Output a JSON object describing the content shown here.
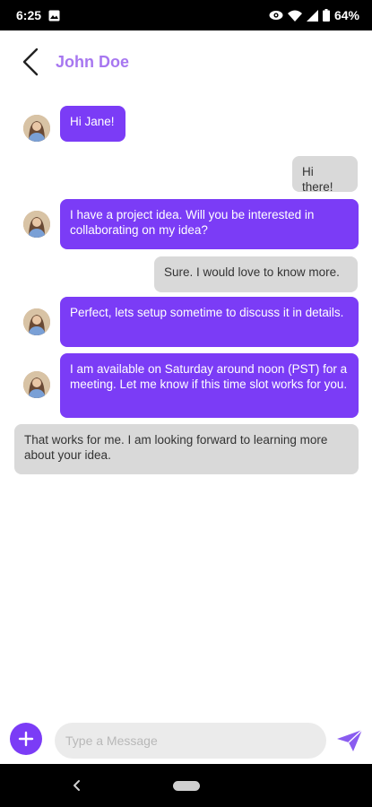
{
  "status_bar": {
    "time": "6:25",
    "battery": "64%",
    "icons": [
      "image-icon",
      "eye-icon",
      "wifi-icon",
      "signal-icon",
      "battery-icon"
    ]
  },
  "header": {
    "back_icon": "chevron-left-icon",
    "contact_name": "John Doe"
  },
  "messages": [
    {
      "from": "contact",
      "text": "Hi Jane!"
    },
    {
      "from": "me",
      "text": "Hi there!"
    },
    {
      "from": "contact",
      "text": "I have a project idea. Will you be interested in collaborating on my idea?"
    },
    {
      "from": "me",
      "text": "Sure. I would love to know more."
    },
    {
      "from": "contact",
      "text": "Perfect, lets setup sometime to discuss it in details."
    },
    {
      "from": "contact",
      "text": "I am available on Saturday around noon (PST) for a meeting. Let me know if this time slot works for you."
    },
    {
      "from": "me",
      "text": "That works for me. I am looking forward to learning more about your idea."
    }
  ],
  "composer": {
    "placeholder": "Type a Message",
    "value": "",
    "add_icon": "plus-icon",
    "send_icon": "send-icon"
  },
  "colors": {
    "accent": "#7b3cf6",
    "name": "#a777f0",
    "outgoing_bubble": "#d9d9d9",
    "input_bg": "#ebebeb"
  }
}
